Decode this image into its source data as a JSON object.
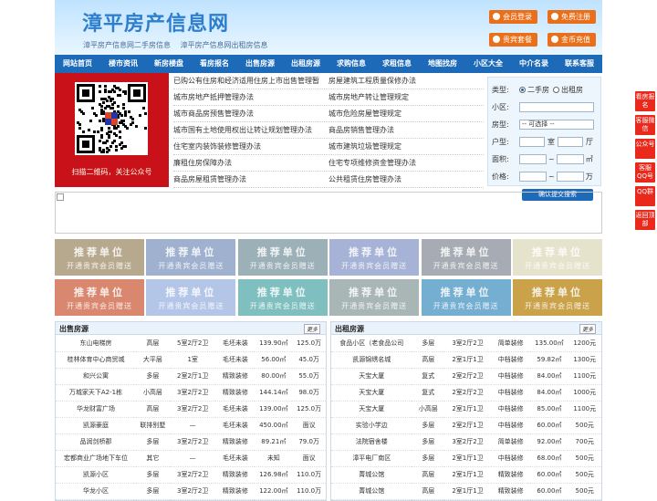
{
  "header": {
    "logo": "漳平房产信息网",
    "sub_links": [
      "漳平房产信息网二手房信息",
      "漳平房产信息网出租房信息"
    ],
    "buttons": [
      "会员登录",
      "免费注册",
      "贵宾套餐",
      "金币充值"
    ]
  },
  "nav": [
    "网站首页",
    "楼市资讯",
    "新房楼盘",
    "看房报名",
    "出售房源",
    "出租房源",
    "求购信息",
    "求租信息",
    "地图找房",
    "小区大全",
    "中介名录",
    "联系客服"
  ],
  "qr": {
    "caption": "扫描二维码，关注公众号"
  },
  "news": [
    [
      "已购公有住房和经济适用住房上市出售管理暂",
      "房屋建筑工程质量保修办法"
    ],
    [
      "城市房地产抵押管理办法",
      "城市房地产转让管理规定"
    ],
    [
      "城市商品房预售管理办法",
      "城市危险房屋管理规定"
    ],
    [
      "城市国有土地使用权出让转让规划管理办法",
      "商品房销售管理办法"
    ],
    [
      "住宅室内装饰装修管理办法",
      "城市建筑垃圾管理规定"
    ],
    [
      "廉租住房保障办法",
      "住宅专项维修资金管理办法"
    ],
    [
      "商品房屋租赁管理办法",
      "公共租赁住房管理办法"
    ]
  ],
  "search": {
    "type_label": "类型:",
    "opt1": "二手房",
    "opt2": "出租房",
    "area_label": "小区:",
    "housetype_label": "房型:",
    "housetype_value": "-- 可选择 --",
    "layout_label": "户型:",
    "room": "室",
    "hall": "厅",
    "size_label": "面积:",
    "size_unit": "㎡",
    "price_label": "价格:",
    "price_unit": "万",
    "tilde": "~",
    "submit": "确认提交搜索"
  },
  "rec": {
    "line1": "推荐单位",
    "line2": "开通贵宾会员赠送"
  },
  "rec_colors": [
    "#b7a98e",
    "#9fb1cf",
    "#9cb0b8",
    "#a7b3d6",
    "#a7abb3",
    "#e6e3cc",
    "#d9876e",
    "#b4c6e8",
    "#7fbfc0",
    "#a9b6b6",
    "#74aed0",
    "#c9a24a"
  ],
  "sale": {
    "title": "出售房源",
    "more": "更多",
    "rows": [
      [
        "东山电梯房",
        "高层",
        "5室2厅2卫",
        "毛坯未装",
        "139.90㎡",
        "125.0万"
      ],
      [
        "桂林体育中心商贸城",
        "大平层",
        "1室",
        "毛坯未装",
        "56.00㎡",
        "45.0万"
      ],
      [
        "和兴公寓",
        "多层",
        "2室2厅1卫",
        "精致装修",
        "80.00㎡",
        "55.0万"
      ],
      [
        "万城家天下A2-1栋",
        "小高层",
        "3室2厅2卫",
        "精致装修",
        "144.14㎡",
        "98.0万"
      ],
      [
        "华龙财富广场",
        "高层",
        "3室2厅2卫",
        "毛坯未装",
        "139.00㎡",
        "125.0万"
      ],
      [
        "凯源豪庭",
        "联排别墅",
        "—",
        "毛坯未装",
        "450.00㎡",
        "面议"
      ],
      [
        "品润剑桥郡",
        "多层",
        "3室2厅2卫",
        "精致装修",
        "89.21㎡",
        "79.0万"
      ],
      [
        "宏都商业广场地下车位",
        "其它",
        "—",
        "毛坯未装",
        "未知",
        "面议"
      ],
      [
        "凯源小区",
        "多层",
        "3室2厅2卫",
        "精致装修",
        "126.98㎡",
        "110.0万"
      ],
      [
        "华龙小区",
        "多层",
        "3室2厅2卫",
        "精致装修",
        "122.00㎡",
        "110.0万"
      ]
    ]
  },
  "rent": {
    "title": "出租房源",
    "more": "更多",
    "rows": [
      [
        "食品小区（老食品公司",
        "多层",
        "3室2厅2卫",
        "简单装修",
        "135.00㎡",
        "1200元"
      ],
      [
        "凯源锦绣名城",
        "高层",
        "2室1厅1卫",
        "中档装修",
        "59.82㎡",
        "1300元"
      ],
      [
        "天宝大厦",
        "复式",
        "2室2厅2卫",
        "中档装修",
        "84.00㎡",
        "1100元"
      ],
      [
        "天宝大厦",
        "复式",
        "2室2厅2卫",
        "中档装修",
        "84.00㎡",
        "1000元"
      ],
      [
        "天宝大厦",
        "小高层",
        "2室1厅1卫",
        "中档装修",
        "85.00㎡",
        "1100元"
      ],
      [
        "实验小学边",
        "多层",
        "2室2厅1卫",
        "中档装修",
        "60.00㎡",
        "500元"
      ],
      [
        "法院宿舍楼",
        "多层",
        "3室2厅2卫",
        "简单装修",
        "92.00㎡",
        "700元"
      ],
      [
        "漳平电厂南区",
        "多层",
        "2室1厅1卫",
        "中档装修",
        "68.00㎡",
        "500元"
      ],
      [
        "菁城公馆",
        "高层",
        "2室1厅1卫",
        "精致装修",
        "60.00㎡",
        "500元"
      ],
      [
        "菁城公馆",
        "高层",
        "2室1厅1卫",
        "精致装修",
        "60.00㎡",
        "500元"
      ]
    ]
  },
  "float": [
    "看房报名",
    "客服微信",
    "公众号",
    "客服QQ号",
    "QQ群",
    "返回顶部"
  ]
}
